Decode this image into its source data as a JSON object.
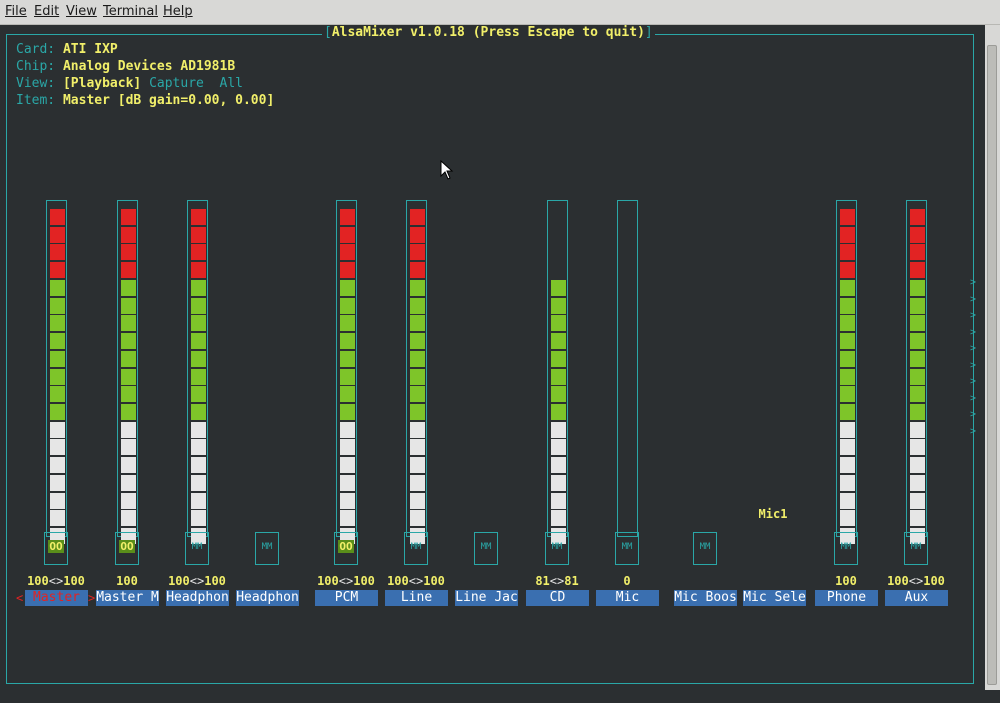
{
  "menu": [
    "File",
    "Edit",
    "View",
    "Terminal",
    "Help"
  ],
  "window_title": "AlsaMixer v1.0.18 (Press Escape to quit)",
  "info": {
    "card_label": "Card:",
    "card": "ATI IXP",
    "chip_label": "Chip:",
    "chip": "Analog Devices AD1981B",
    "view_label": "View:",
    "view_playback": "[Playback]",
    "view_capture": "Capture",
    "view_all": "All",
    "item_label": "Item:",
    "item": "Master [dB gain=0.00, 0.00]"
  },
  "extra_label": "Mic1",
  "channels": [
    {
      "name": "Master",
      "level": 100,
      "value_left": "100",
      "arrow": "<>",
      "value_right": "100",
      "switch": "OO",
      "selected": true
    },
    {
      "name": "Master M",
      "level": 100,
      "value_left": "100",
      "arrow": "",
      "value_right": "",
      "switch": "OO"
    },
    {
      "name": "Headphon",
      "level": 100,
      "value_left": "100",
      "arrow": "<>",
      "value_right": "100",
      "switch": "MM"
    },
    {
      "name": "Headphon",
      "level": null,
      "value_left": "",
      "arrow": "",
      "value_right": "",
      "switch": "MM"
    },
    {
      "name": "PCM",
      "level": 100,
      "value_left": "100",
      "arrow": "<>",
      "value_right": "100",
      "switch": "OO"
    },
    {
      "name": "Line",
      "level": 100,
      "value_left": "100",
      "arrow": "<>",
      "value_right": "100",
      "switch": "MM"
    },
    {
      "name": "Line Jac",
      "level": null,
      "value_left": "",
      "arrow": "",
      "value_right": "",
      "switch": "MM"
    },
    {
      "name": "CD",
      "level": 81,
      "value_left": "81",
      "arrow": "<>",
      "value_right": "81",
      "switch": "MM"
    },
    {
      "name": "Mic",
      "level": 0,
      "value_left": "0",
      "arrow": "",
      "value_right": "",
      "switch": "MM"
    },
    {
      "name": "Mic Boos",
      "level": null,
      "value_left": "",
      "arrow": "",
      "value_right": "",
      "switch": "MM"
    },
    {
      "name": "Mic Sele",
      "level": null,
      "value_left": "",
      "arrow": "",
      "value_right": "",
      "switch": ""
    },
    {
      "name": "Phone",
      "level": 100,
      "value_left": "100",
      "arrow": "",
      "value_right": "",
      "switch": "MM"
    },
    {
      "name": "Aux",
      "level": 100,
      "value_left": "100",
      "arrow": "<>",
      "value_right": "100",
      "switch": "MM"
    }
  ],
  "selection_marks": {
    "left": "<",
    "right": ">"
  },
  "more_indicator": ">",
  "colors": {
    "border": "#2aa7a7",
    "text": "#f1ef6a",
    "red": "#e22323",
    "green": "#7ec529",
    "white": "#e6e6e6",
    "label_bg": "#3a6fb0"
  }
}
